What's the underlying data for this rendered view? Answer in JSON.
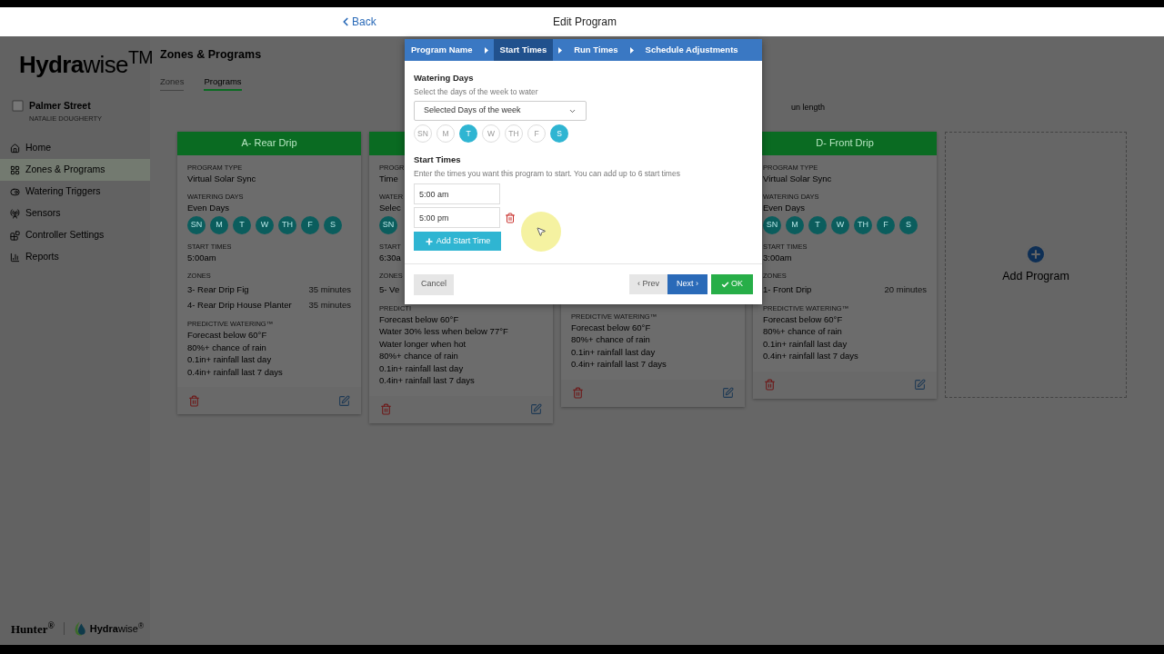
{
  "top_bar": {
    "back": "Back",
    "title": "Edit Program"
  },
  "sidebar": {
    "logo": "**Hydra**wise$^{TM}$",
    "site": {
      "name": "Palmer Street",
      "owner": "NATALIE DOUGHERTY"
    },
    "items": [
      {
        "label": "Home",
        "selected": false
      },
      {
        "label": "Zones & Programs",
        "selected": true
      },
      {
        "label": "Watering Triggers",
        "selected": false
      },
      {
        "label": "Sensors",
        "selected": false
      },
      {
        "label": "Controller Settings",
        "selected": false
      },
      {
        "label": "Reports",
        "selected": false
      }
    ],
    "footer": {
      "brand": "Hunter$^{®}$",
      "logo": "**Hydra**wise$^{®}$"
    }
  },
  "page": {
    "title": "Zones & Programs",
    "tabs": [
      {
        "label": "Zones",
        "selected": false
      },
      {
        "label": "Programs",
        "selected": true
      }
    ],
    "note": "un length"
  },
  "programs": [
    {
      "header": "A- Rear Drip",
      "program_type_label": "PROGRAM TYPE",
      "program_type": "Virtual Solar Sync",
      "watering_days_label": "WATERING DAYS",
      "watering_days": "Even Days",
      "days": [
        {
          "label": "SN",
          "selected": true
        },
        {
          "label": "M",
          "selected": true
        },
        {
          "label": "T",
          "selected": true
        },
        {
          "label": "W",
          "selected": true
        },
        {
          "label": "TH",
          "selected": true
        },
        {
          "label": "F",
          "selected": true
        },
        {
          "label": "S",
          "selected": true
        }
      ],
      "start_times_label": "START TIMES",
      "start_time": "5:00am",
      "zones_label": "ZONES",
      "zones": [
        {
          "name": "3- Rear Drip Fig",
          "duration": "35 minutes"
        },
        {
          "name": "4- Rear Drip House Planter",
          "duration": "35 minutes"
        }
      ],
      "predictive_label": "PREDICTIVE WATERING™",
      "predictive": [
        "Forecast below 60°F",
        "80%+ chance of rain",
        "0.1in+ rainfall last day",
        "0.4in+ rainfall last 7 days"
      ]
    },
    {
      "program_type_label": "PROGR",
      "program_type": "Time",
      "watering_days_label": "WATER",
      "watering_days": "Selec",
      "days": [
        {
          "label": "SN",
          "selected": true
        }
      ],
      "start_times_label": "START",
      "start_time": "6:30a",
      "zones_label": "ZONES",
      "zones": [
        {
          "name": "5- Ve"
        }
      ],
      "predictive_label": "PREDICTI",
      "predictive": [
        "Forecast below 60°F",
        "Water 30% less when below 77°F",
        "Water longer when hot",
        "80%+ chance of rain",
        "0.1in+ rainfall last day",
        "0.4in+ rainfall last 7 days"
      ]
    },
    {
      "predictive_label": "PREDICTIVE WATERING™",
      "predictive": [
        "Forecast below 60°F",
        "80%+ chance of rain",
        "0.1in+ rainfall last day",
        "0.4in+ rainfall last 7 days"
      ]
    },
    {
      "header": "D- Front Drip",
      "program_type_label": "PROGRAM TYPE",
      "program_type": "Virtual Solar Sync",
      "watering_days_label": "WATERING DAYS",
      "watering_days": "Even Days",
      "days": [
        {
          "label": "SN",
          "selected": true
        },
        {
          "label": "M",
          "selected": true
        },
        {
          "label": "T",
          "selected": true
        },
        {
          "label": "W",
          "selected": true
        },
        {
          "label": "TH",
          "selected": true
        },
        {
          "label": "F",
          "selected": true
        },
        {
          "label": "S",
          "selected": true
        }
      ],
      "start_times_label": "START TIMES",
      "start_time": "3:00am",
      "zones_label": "ZONES",
      "zones": [
        {
          "name": "1- Front Drip",
          "duration": "20 minutes"
        }
      ],
      "predictive_label": "PREDICTIVE WATERING™",
      "predictive": [
        "Forecast below 60°F",
        "80%+ chance of rain",
        "0.1in+ rainfall last day",
        "0.4in+ rainfall last 7 days"
      ]
    }
  ],
  "add_program": "Add Program",
  "modal": {
    "tabs": [
      {
        "label": "Program Name",
        "selected": false
      },
      {
        "label": "Start Times",
        "selected": true
      },
      {
        "label": "Run Times",
        "selected": false
      },
      {
        "label": "Schedule Adjustments",
        "selected": false
      }
    ],
    "watering": {
      "title": "Watering Days",
      "hint": "Select the days of the week to water",
      "select": "Selected Days of the week",
      "days": [
        {
          "label": "SN",
          "selected": false
        },
        {
          "label": "M",
          "selected": false
        },
        {
          "label": "T",
          "selected": true
        },
        {
          "label": "W",
          "selected": false
        },
        {
          "label": "TH",
          "selected": false
        },
        {
          "label": "F",
          "selected": false
        },
        {
          "label": "S",
          "selected": true
        }
      ]
    },
    "start": {
      "title": "Start Times",
      "hint": "Enter the times you want this program to start. You can add up to 6 start times",
      "times": [
        {
          "value": "5:00 am",
          "removable": false
        },
        {
          "value": "5:00 pm",
          "removable": true
        }
      ],
      "add": "Add Start Time"
    },
    "cancel": "Cancel",
    "prev": "‹ Prev",
    "next": "Next ›",
    "ok": "OK"
  }
}
